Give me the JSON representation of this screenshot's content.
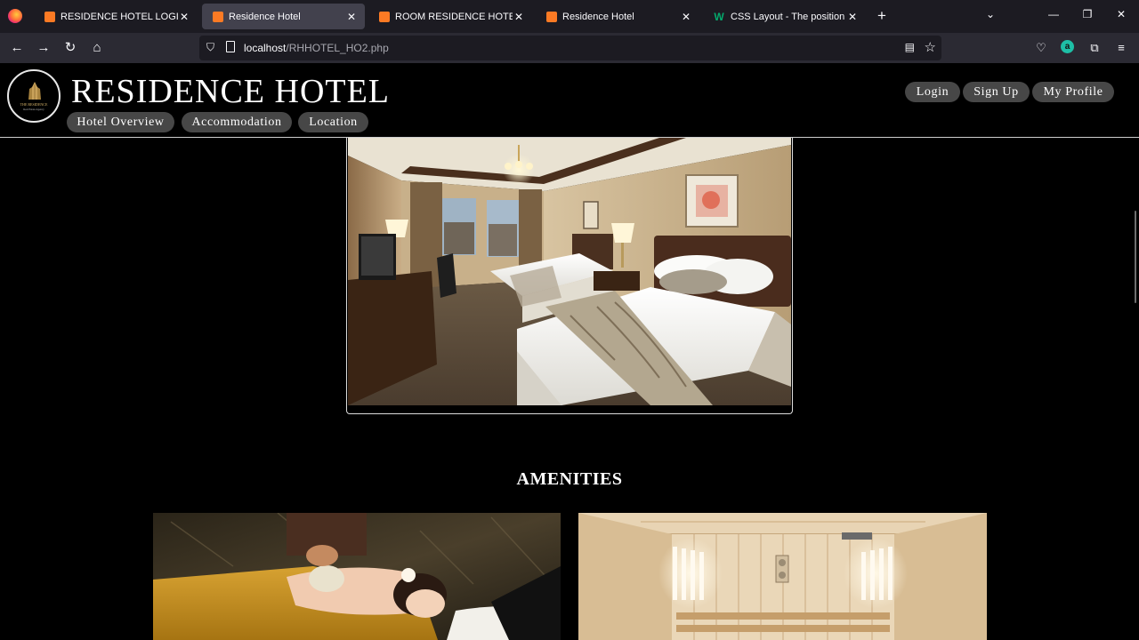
{
  "browser": {
    "tabs": [
      {
        "title": "RESIDENCE HOTEL LOGIN",
        "active": false
      },
      {
        "title": "Residence Hotel",
        "active": true
      },
      {
        "title": "ROOM RESIDENCE HOTEL",
        "active": false
      },
      {
        "title": "Residence Hotel",
        "active": false
      },
      {
        "title": "CSS Layout - The position Property",
        "active": false
      }
    ],
    "url_host": "localhost",
    "url_path": "/RHHOTEL_HO2.php",
    "account_initial": "a",
    "icons": {
      "close": "✕",
      "new_tab": "+",
      "list_tabs": "⌄",
      "minimize": "—",
      "restore": "❐",
      "window_close": "✕",
      "back": "←",
      "forward": "→",
      "reload": "↻",
      "home": "⌂",
      "shield": "⛉",
      "reader": "▤",
      "star": "☆",
      "pocket": "♡",
      "extensions": "⧉",
      "menu": "≡"
    }
  },
  "site": {
    "logo_line1": "THE RESIDENCE",
    "logo_line2": "Real Estate Agency",
    "brand": "RESIDENCE HOTEL",
    "nav": [
      "Hotel Overview",
      "Accommodation",
      "Location"
    ],
    "account": [
      "Login",
      "Sign Up",
      "My Profile"
    ]
  },
  "content": {
    "amenities_title": "AMENITIES"
  }
}
